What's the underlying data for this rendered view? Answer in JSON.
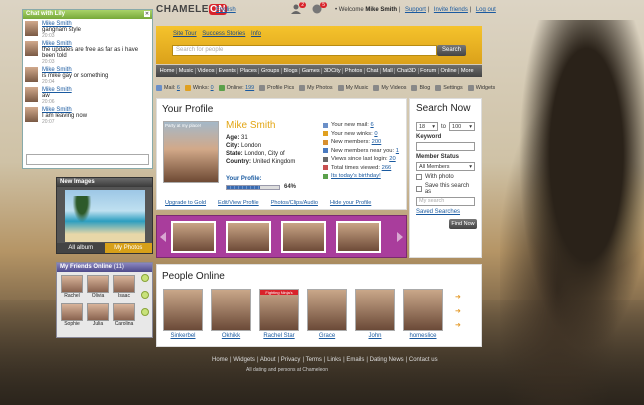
{
  "header": {
    "logo_main": "CHAMELE",
    "logo_on": "ON",
    "language": "English",
    "notif_badge_1": "2",
    "notif_badge_2": "5",
    "welcome_prefix": "Welcome",
    "username": "Mike Smith",
    "support": "Support",
    "invite": "Invite friends",
    "logout": "Log out"
  },
  "chat": {
    "title": "Chat with Lily",
    "messages": [
      {
        "name": "Mike Smith",
        "text": "gangnam style",
        "time": "20:03"
      },
      {
        "name": "Mike Smith",
        "text": "the updates are free as far as i have been told",
        "time": "20:03"
      },
      {
        "name": "Mike Smith",
        "text": "is mike gay or something",
        "time": "20:04"
      },
      {
        "name": "Mike Smith",
        "text": "aw",
        "time": "20:06"
      },
      {
        "name": "Mike Smith",
        "text": "I am leaving now",
        "time": "20:07"
      }
    ]
  },
  "new_images": {
    "title": "New Images",
    "tab_all": "All album",
    "tab_my": "My Photos"
  },
  "friends": {
    "title": "My Friends Online",
    "count": "(11)",
    "names": [
      "Rachel",
      "Olivia",
      "Isaac",
      "Sophie",
      "Julia",
      "Carolina"
    ]
  },
  "search_bar": {
    "links": [
      "Site Tour",
      "Success Stories",
      "Info"
    ],
    "placeholder": "Search for people",
    "button": "Search"
  },
  "nav": [
    "Home",
    "Music",
    "Videos",
    "Events",
    "Places",
    "Groups",
    "Blogs",
    "Games",
    "3DCity",
    "Photos",
    "Chat",
    "Mall",
    "Chat3D",
    "Forum",
    "Online",
    "More"
  ],
  "stats": {
    "mail_label": "Mail:",
    "mail_val": "6",
    "winks_label": "Winks:",
    "winks_val": "0",
    "online_label": "Online:",
    "online_val": "199",
    "profile_pics": "Profile Pics",
    "my_photos": "My Photos",
    "my_music": "My Music",
    "my_videos": "My Videos",
    "blog": "Blog",
    "settings": "Settings",
    "widgets": "Widgets"
  },
  "profile": {
    "heading": "Your Profile",
    "pic_label": "Party at my place!",
    "name": "Mike Smith",
    "age_label": "Age:",
    "age": "31",
    "city_label": "City:",
    "city": "London",
    "state_label": "State:",
    "state": "London, City of",
    "country_label": "Country:",
    "country": "United Kingdom",
    "progress_label": "Your Profile:",
    "progress": 64,
    "progress_text": "64%",
    "notices": [
      {
        "text": "Your new mail:",
        "val": "6"
      },
      {
        "text": "Your new winks:",
        "val": "0"
      },
      {
        "text": "New members:",
        "val": "200"
      },
      {
        "text": "New members near you:",
        "val": "1"
      },
      {
        "text": "Views since last login:",
        "val": "20"
      },
      {
        "text": "Total times viewed:",
        "val": "266"
      },
      {
        "text": "Its today's birthday!",
        "val": ""
      }
    ],
    "links": [
      "Upgrade to Gold",
      "Edit/View Profile",
      "Photos/Clips/Audio",
      "Hide your Profile"
    ]
  },
  "search_now": {
    "heading": "Search Now",
    "age_from": "18",
    "to_label": "to",
    "age_to": "100",
    "keyword_label": "Keyword",
    "member_status_label": "Member Status",
    "status_value": "All Members",
    "with_photo": "With photo",
    "save_search": "Save this search as",
    "save_placeholder": "My search",
    "saved_searches": "Saved Searches",
    "find_button": "Find Now"
  },
  "people_online": {
    "heading": "People Online",
    "tag": "Fighting Ninja's",
    "names": [
      "Sinkerbel",
      "Okhikk",
      "Rachel Star",
      "Grace",
      "John",
      "homeslice"
    ]
  },
  "footer": {
    "links": [
      "Home",
      "Widgets",
      "About",
      "Privacy",
      "Terms",
      "Links",
      "Emails",
      "Dating News",
      "Contact us"
    ],
    "copyright": "All dating and persons at Chameleon"
  },
  "colors": {
    "accent_yellow": "#e2a513",
    "nav_bg": "#555555",
    "link_blue": "#1a5aa0",
    "strip_purple": "#a93d9c",
    "brand_red": "#d8232a"
  }
}
